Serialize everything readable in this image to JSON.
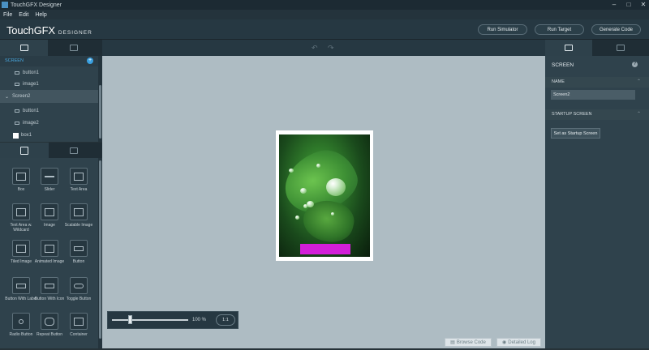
{
  "window": {
    "title": "TouchGFX Designer"
  },
  "menu": [
    "File",
    "Edit",
    "Help"
  ],
  "header": {
    "logo_main": "TouchGFX",
    "logo_sub": "DESIGNER",
    "run_simulator": "Run Simulator",
    "run_target": "Run Target",
    "generate_code": "Generate Code"
  },
  "screens_panel": {
    "header": "SCREEN",
    "tree": [
      {
        "label": "button1",
        "indent": 2,
        "icon": "button-icon"
      },
      {
        "label": "image1",
        "indent": 2,
        "icon": "image-icon"
      },
      {
        "label": "Screen2",
        "indent": 1,
        "icon": "chevron-icon",
        "selected": true
      },
      {
        "label": "button1",
        "indent": 2,
        "icon": "button-icon"
      },
      {
        "label": "image2",
        "indent": 2,
        "icon": "image-icon"
      },
      {
        "label": "box1",
        "indent": 2,
        "icon": "box-icon"
      }
    ]
  },
  "widgets": [
    {
      "label": "Box",
      "icon": "box-widget-icon"
    },
    {
      "label": "Slider",
      "icon": "slider-widget-icon"
    },
    {
      "label": "Text Area",
      "icon": "text-area-widget-icon"
    },
    {
      "label": "Text Area w. Wildcard",
      "icon": "text-area-wildcard-widget-icon"
    },
    {
      "label": "Image",
      "icon": "image-widget-icon"
    },
    {
      "label": "Scalable Image",
      "icon": "scalable-image-widget-icon"
    },
    {
      "label": "Tiled Image",
      "icon": "tiled-image-widget-icon"
    },
    {
      "label": "Animated Image",
      "icon": "animated-image-widget-icon"
    },
    {
      "label": "Button",
      "icon": "button-widget-icon"
    },
    {
      "label": "Button With Label",
      "icon": "button-with-label-widget-icon"
    },
    {
      "label": "Button With Icon",
      "icon": "button-with-icon-widget-icon"
    },
    {
      "label": "Toggle Button",
      "icon": "toggle-button-widget-icon"
    },
    {
      "label": "Radio Button",
      "icon": "radio-button-widget-icon"
    },
    {
      "label": "Repeat Button",
      "icon": "repeat-button-widget-icon"
    },
    {
      "label": "Container",
      "icon": "container-widget-icon"
    }
  ],
  "canvas": {
    "zoom_text": "100 %",
    "zoom_reset": "1:1",
    "zoom_level": 1.0
  },
  "status": {
    "browse_code": "Browse Code",
    "detailed_log": "Detailed Log"
  },
  "properties": {
    "title": "SCREEN",
    "help": "?",
    "name_section": "NAME",
    "name_value": "Screen2",
    "startup_section": "STARTUP SCREEN",
    "startup_button": "Set as Startup Screen"
  },
  "colors": {
    "accent": "#3aa0e0",
    "widget_bar": "#d21fd8",
    "canvas_bg": "#aebcc3"
  }
}
